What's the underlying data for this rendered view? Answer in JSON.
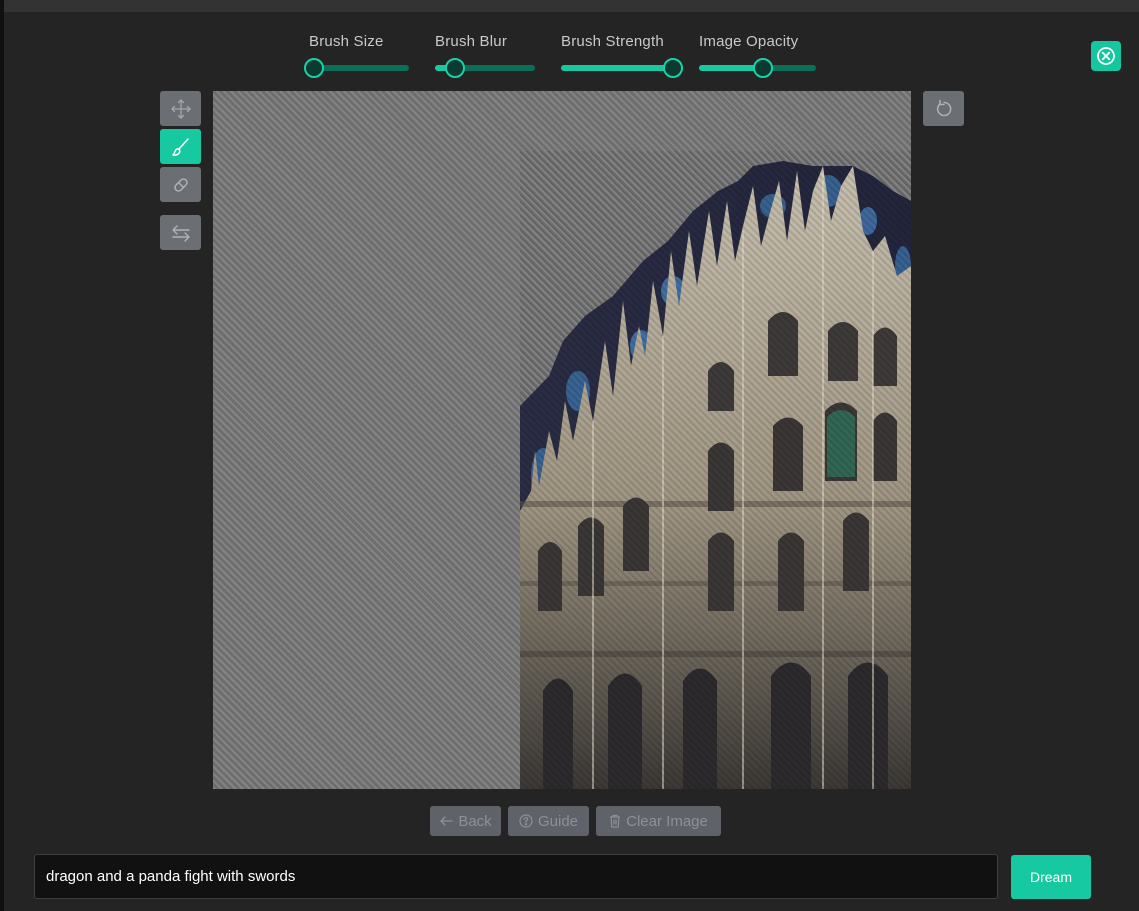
{
  "sliders": [
    {
      "label": "Brush Size",
      "value": 0.07
    },
    {
      "label": "Brush Blur",
      "value": 0.2
    },
    {
      "label": "Brush Strength",
      "value": 0.92
    },
    {
      "label": "Image Opacity",
      "value": 0.55
    }
  ],
  "tools": [
    {
      "name": "move-tool",
      "icon": "move-arrows-icon",
      "active": false
    },
    {
      "name": "brush-tool",
      "icon": "paintbrush-icon",
      "active": true
    },
    {
      "name": "eraser-tool",
      "icon": "eraser-icon",
      "active": false
    },
    {
      "name": "swap-tool",
      "icon": "swap-arrows-icon",
      "active": false
    }
  ],
  "undo": {
    "icon": "undo-icon"
  },
  "close": {
    "icon": "close-circle-icon"
  },
  "bottom_buttons": {
    "back_label": "Back",
    "guide_label": "Guide",
    "clear_label": "Clear Image"
  },
  "prompt": {
    "value": "dragon and a panda fight with swords"
  },
  "dream_label": "Dream",
  "colors": {
    "accent": "#17c9a0",
    "background": "#242424",
    "button_gray": "#6b6e73",
    "track_dark": "#0b6e58"
  }
}
